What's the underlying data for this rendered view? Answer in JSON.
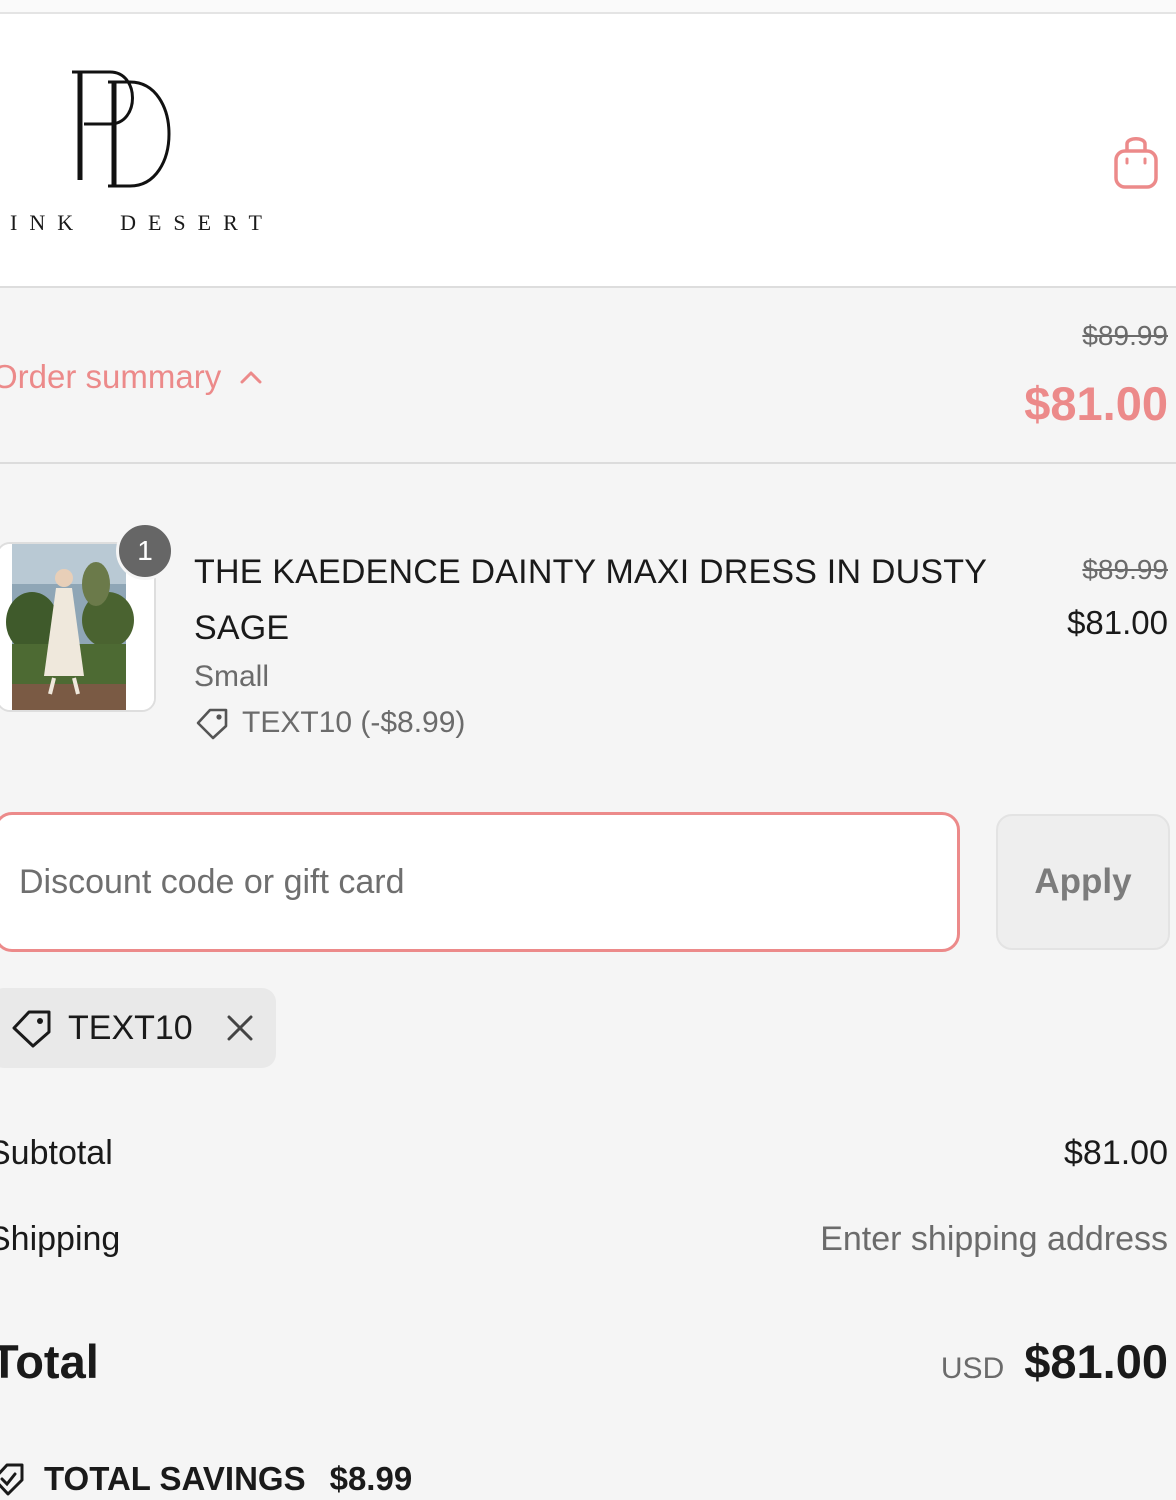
{
  "brand": {
    "logo_monogram": "PD",
    "wordmark": "INK  DESERT"
  },
  "colors": {
    "accent": "#ec8a8a",
    "muted_text": "#6b6b6b",
    "background": "#f5f5f5"
  },
  "header": {
    "cart_icon": "shopping-bag-icon"
  },
  "order_summary": {
    "toggle_label": "Order summary",
    "toggle_icon": "chevron-up-icon",
    "original_price": "$89.99",
    "price": "$81.00"
  },
  "line_item": {
    "quantity": "1",
    "title": "THE KAEDENCE DAINTY MAXI DRESS IN DUSTY SAGE",
    "variant": "Small",
    "discount_text": "TEXT10 (-$8.99)",
    "discount_icon": "tag-icon",
    "original_price": "$89.99",
    "price": "$81.00"
  },
  "discount": {
    "placeholder": "Discount code or gift card",
    "value": "",
    "apply_label": "Apply",
    "applied_code": "TEXT10",
    "remove_icon": "close-icon"
  },
  "totals": {
    "subtotal_label": "Subtotal",
    "subtotal_value": "$81.00",
    "shipping_label": "Shipping",
    "shipping_value": "Enter shipping address",
    "total_label": "Total",
    "currency": "USD",
    "total_value": "$81.00",
    "savings_label": "TOTAL SAVINGS",
    "savings_value": "$8.99",
    "savings_icon": "savings-tag-icon"
  }
}
